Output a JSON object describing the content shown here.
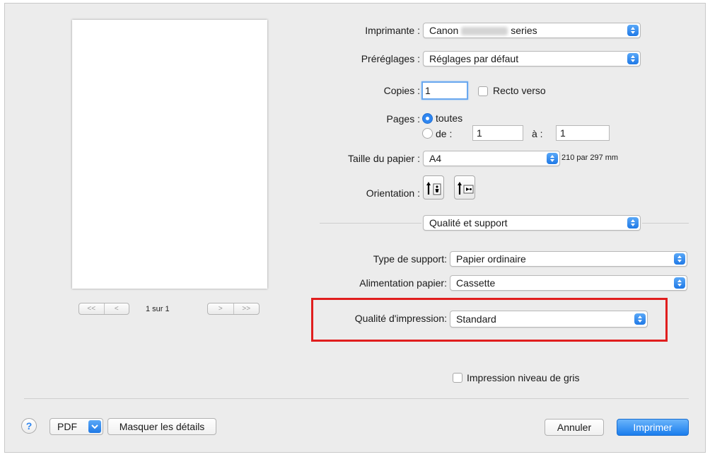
{
  "dialog": {
    "printer": {
      "label": "Imprimante :",
      "value_prefix": "Canon",
      "value_suffix": "series"
    },
    "presets": {
      "label": "Préréglages :",
      "value": "Réglages par défaut"
    },
    "copies": {
      "label": "Copies :",
      "value": "1",
      "duplex_label": "Recto verso",
      "duplex_checked": false
    },
    "pages": {
      "label": "Pages :",
      "all_label": "toutes",
      "range_from_label": "de :",
      "from_value": "1",
      "range_to_label": "à :",
      "to_value": "1",
      "selected": "toutes"
    },
    "paper_size": {
      "label": "Taille du papier :",
      "value": "A4",
      "dimensions": "210 par 297 mm"
    },
    "orientation": {
      "label": "Orientation :",
      "options": [
        "portrait",
        "landscape"
      ],
      "selected": "portrait"
    },
    "section": {
      "value": "Qualité et support"
    },
    "media_type": {
      "label": "Type de support:",
      "value": "Papier ordinaire"
    },
    "paper_source": {
      "label": "Alimentation papier:",
      "value": "Cassette"
    },
    "print_quality": {
      "label": "Qualité d'impression:",
      "value": "Standard"
    },
    "grayscale": {
      "label": "Impression niveau de gris",
      "checked": false
    },
    "preview": {
      "page_count": "1 sur 1",
      "nav_first": "<<",
      "nav_prev": "<",
      "nav_next": ">",
      "nav_last": ">>"
    },
    "footer": {
      "help": "?",
      "pdf": "PDF",
      "hide_details": "Masquer les détails",
      "cancel": "Annuler",
      "print": "Imprimer"
    }
  },
  "colors": {
    "accent": "#2f86f0",
    "highlight": "#e01e1e"
  }
}
